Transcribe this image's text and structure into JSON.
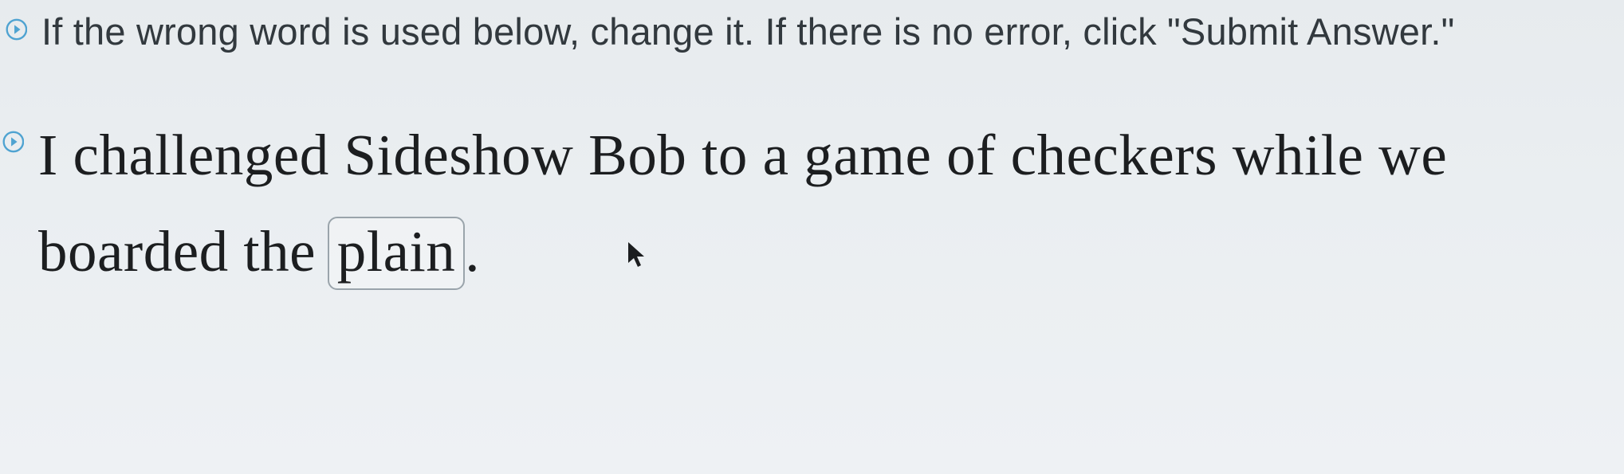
{
  "instruction": {
    "text": "If the wrong word is used below, change it. If there is no error, click \"Submit Answer.\""
  },
  "sentence": {
    "prefix": "I challenged Sideshow Bob to a game of checkers while we boarded the ",
    "editable_word": "plain",
    "suffix": "."
  },
  "icons": {
    "bullet": "chevron-circle-right"
  }
}
